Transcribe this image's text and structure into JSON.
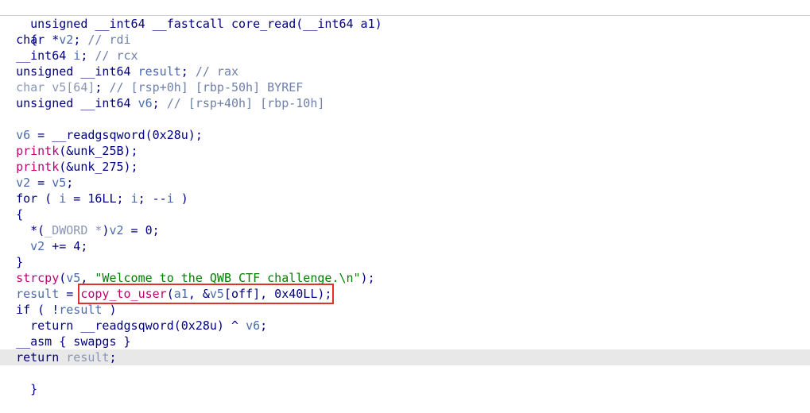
{
  "colors": {
    "keyword": "#000080",
    "variable": "#4a6aa8",
    "comment": "#7080a8",
    "function_call": "#c00070",
    "string": "#008000",
    "highlight_line": "#e8e8e8",
    "annotation_box": "#e03030"
  },
  "code": {
    "signature": "unsigned __int64 __fastcall core_read(__int64 a1)",
    "open_brace": "{",
    "decl_v2": {
      "type": "char *",
      "name": "v2",
      "rest": ";",
      "comment": "// rdi"
    },
    "decl_i": {
      "type": "__int64 ",
      "name": "i",
      "rest": ";",
      "comment": "// rcx"
    },
    "decl_result": {
      "type": "unsigned __int64 ",
      "name": "result",
      "rest": ";",
      "comment": "// rax"
    },
    "decl_v5": {
      "type": "char ",
      "name": "v5",
      "size": "[64]",
      "rest": ";",
      "comment": "// [rsp+0h] [rbp-50h] BYREF"
    },
    "decl_v6": {
      "type": "unsigned __int64 ",
      "name": "v6",
      "rest": ";",
      "comment": "// [rsp+40h] [rbp-10h]"
    },
    "stmt_v6_assign": {
      "lhs": "v6",
      "op": " = ",
      "rhs": "__readgsqword(0x28u);"
    },
    "stmt_printk1": {
      "fn": "printk",
      "args": "(&unk_25B);"
    },
    "stmt_printk2": {
      "fn": "printk",
      "args": "(&unk_275);"
    },
    "stmt_v2_assign": {
      "lhs": "v2",
      "op": " = ",
      "rhs": "v5",
      "end": ";"
    },
    "stmt_for": {
      "kw": "for",
      "open": " ( ",
      "var1": "i",
      "mid1": " = 16LL; ",
      "var2": "i",
      "mid2": "; --",
      "var3": "i",
      "close": " )"
    },
    "for_open_brace": "{",
    "stmt_deref": {
      "pre": "*(",
      "cast": "_DWORD *",
      "mid": ")",
      "var": "v2",
      "rest": " = 0;"
    },
    "stmt_v2_inc": {
      "var": "v2",
      "rest": " += 4;"
    },
    "for_close_brace": "}",
    "stmt_strcpy": {
      "fn": "strcpy",
      "open": "(",
      "var": "v5",
      "sep": ", ",
      "str": "\"Welcome to the QWB CTF challenge.\\n\"",
      "end": ");"
    },
    "stmt_copy": {
      "lhs": "result",
      "op": " = ",
      "fn": "copy_to_user",
      "open": "(",
      "arg1": "a1",
      "sep1": ", &",
      "arg2": "v5",
      "idx": "[off]",
      "sep2": ", 0x40LL);"
    },
    "stmt_if": {
      "kw": "if",
      "open": " ( !",
      "var": "result",
      "close": " )"
    },
    "stmt_return1": {
      "kw": "return",
      "rest": " __readgsqword(0x28u) ^ ",
      "var": "v6",
      "end": ";"
    },
    "stmt_asm": "__asm { swapgs }",
    "stmt_return2": {
      "kw": "return",
      "sep": " ",
      "var": "result",
      "end": ";"
    },
    "close_brace": "}"
  }
}
